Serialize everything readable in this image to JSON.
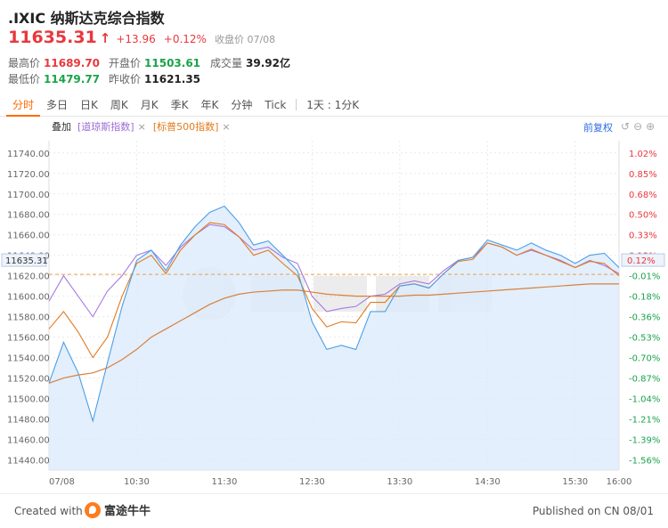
{
  "header": {
    "title": ".IXIC 纳斯达克综合指数",
    "price": "11635.31",
    "change": "+13.96",
    "change_pct": "+0.12%",
    "close_label": "收盘价 07/08",
    "stats": {
      "high_label": "最高价",
      "high_value": "11689.70",
      "low_label": "最低价",
      "low_value": "11479.77",
      "open_label": "开盘价",
      "open_value": "11503.61",
      "prev_label": "昨收价",
      "prev_value": "11621.35",
      "volume_label": "成交量",
      "volume_value": "39.92亿"
    }
  },
  "tabs": [
    "分时",
    "多日",
    "日K",
    "周K",
    "月K",
    "季K",
    "年K",
    "分钟",
    "Tick"
  ],
  "tab_period": "1天 : 1分K",
  "overlay": {
    "label": "叠加",
    "tag1": "[道琼斯指数]",
    "tag2": "[标普500指数]",
    "close_x": "×",
    "restore": "前复权"
  },
  "colors": {
    "main_line": "#4aa0e8",
    "main_fill": "#dcebfb",
    "dow_line": "#a579e0",
    "sp500_line": "#e37a1c",
    "avg_line": "#d9803b",
    "up": "#e8383d",
    "down": "#1aa34a"
  },
  "chart_data": {
    "type": "line",
    "y_ticks": [
      "11740.00",
      "11720.00",
      "11700.00",
      "11680.00",
      "11660.00",
      "11640.00",
      "11620.00",
      "11600.00",
      "11580.00",
      "11560.00",
      "11540.00",
      "11520.00",
      "11500.00",
      "11480.00",
      "11460.00",
      "11440.00"
    ],
    "pct_ticks": [
      "1.02%",
      "0.85%",
      "0.68%",
      "0.50%",
      "0.33%",
      "0.12%",
      "-0.01%",
      "-0.18%",
      "-0.36%",
      "-0.53%",
      "-0.70%",
      "-0.87%",
      "-1.04%",
      "-1.21%",
      "-1.39%",
      "-1.56%"
    ],
    "x_ticks": [
      "07/08",
      "10:30",
      "11:30",
      "12:30",
      "13:30",
      "14:30",
      "15:30",
      "16:00"
    ],
    "ylim": [
      11430,
      11752
    ],
    "prev_close": 11621.35,
    "current_label": "11635.31",
    "current_pct_label": "0.12%",
    "x": [
      "09:30",
      "09:40",
      "09:50",
      "10:00",
      "10:10",
      "10:20",
      "10:30",
      "10:40",
      "10:50",
      "11:00",
      "11:10",
      "11:20",
      "11:30",
      "11:40",
      "11:50",
      "12:00",
      "12:10",
      "12:20",
      "12:30",
      "12:40",
      "12:50",
      "13:00",
      "13:10",
      "13:20",
      "13:30",
      "13:40",
      "13:50",
      "14:00",
      "14:10",
      "14:20",
      "14:30",
      "14:40",
      "14:50",
      "15:00",
      "15:10",
      "15:20",
      "15:30",
      "15:40",
      "15:50",
      "16:00"
    ],
    "series": [
      {
        "name": "IXIC",
        "values": [
          11515,
          11555,
          11525,
          11478,
          11535,
          11590,
          11635,
          11645,
          11625,
          11650,
          11668,
          11682,
          11688,
          11672,
          11650,
          11654,
          11640,
          11625,
          11575,
          11548,
          11552,
          11548,
          11585,
          11585,
          11610,
          11612,
          11608,
          11622,
          11635,
          11638,
          11655,
          11650,
          11645,
          11652,
          11645,
          11640,
          11632,
          11640,
          11642,
          11628
        ]
      },
      {
        "name": "道琼斯指数",
        "values": [
          11595,
          11620,
          11600,
          11580,
          11605,
          11620,
          11640,
          11645,
          11630,
          11648,
          11660,
          11670,
          11668,
          11658,
          11645,
          11648,
          11638,
          11632,
          11600,
          11585,
          11588,
          11590,
          11600,
          11602,
          11612,
          11615,
          11612,
          11625,
          11635,
          11638,
          11652,
          11648,
          11640,
          11645,
          11640,
          11635,
          11628,
          11635,
          11630,
          11622
        ]
      },
      {
        "name": "标普500指数",
        "values": [
          11568,
          11585,
          11565,
          11540,
          11560,
          11600,
          11632,
          11640,
          11622,
          11645,
          11660,
          11672,
          11670,
          11658,
          11640,
          11645,
          11632,
          11620,
          11588,
          11570,
          11575,
          11574,
          11594,
          11594,
          11610,
          11612,
          11608,
          11622,
          11634,
          11636,
          11652,
          11648,
          11640,
          11646,
          11640,
          11634,
          11628,
          11634,
          11632,
          11620
        ]
      },
      {
        "name": "avg",
        "values": [
          11515,
          11520,
          11523,
          11525,
          11530,
          11538,
          11548,
          11560,
          11568,
          11576,
          11584,
          11592,
          11598,
          11602,
          11604,
          11605,
          11606,
          11606,
          11604,
          11602,
          11601,
          11600,
          11600,
          11600,
          11600,
          11601,
          11601,
          11602,
          11603,
          11604,
          11605,
          11606,
          11607,
          11608,
          11609,
          11610,
          11611,
          11612,
          11612,
          11612
        ]
      }
    ]
  },
  "footer": {
    "created": "Created with",
    "brand": "富途牛牛",
    "published": "Published on CN 08/01"
  }
}
